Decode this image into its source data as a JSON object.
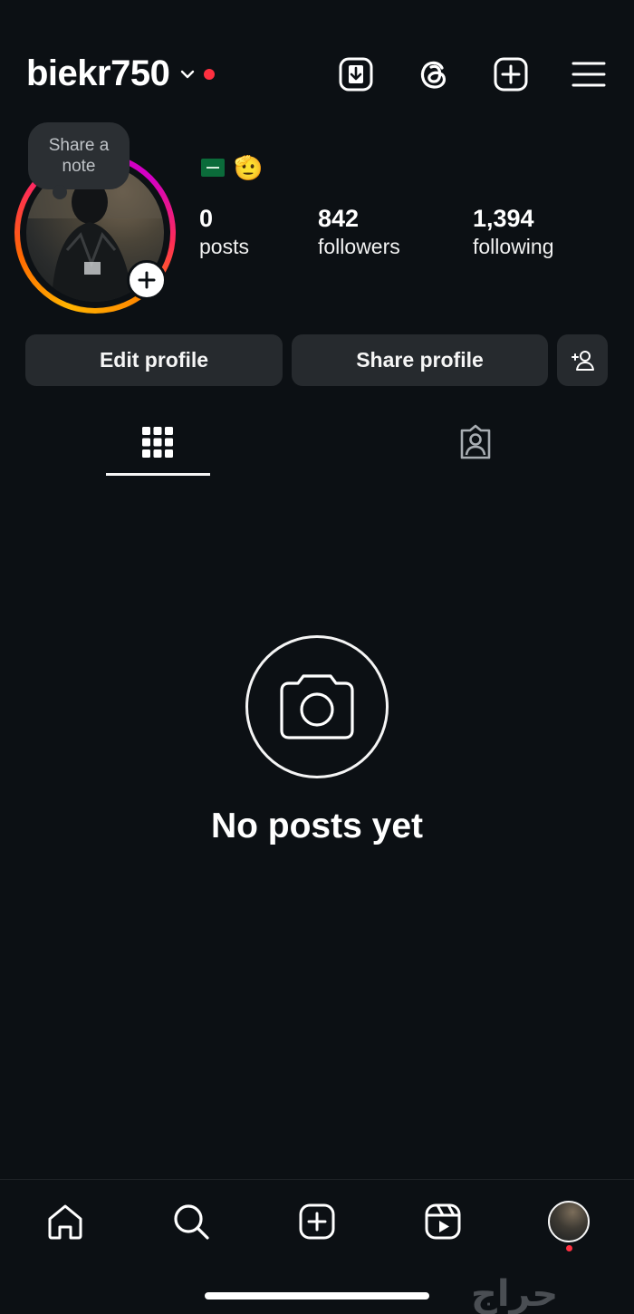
{
  "header": {
    "username": "biekr750",
    "icons": [
      "download-box-icon",
      "threads-icon",
      "add-post-icon",
      "menu-icon"
    ]
  },
  "note": {
    "text_line1": "Share a",
    "text_line2": "note"
  },
  "bio": {
    "emojis": [
      "saudi-flag",
      "saluting-hand"
    ],
    "hand_char": "🫡"
  },
  "stats": {
    "posts": {
      "value": "0",
      "label": "posts"
    },
    "followers": {
      "value": "842",
      "label": "followers"
    },
    "following": {
      "value": "1,394",
      "label": "following"
    }
  },
  "actions": {
    "edit_profile": "Edit profile",
    "share_profile": "Share profile",
    "discover_people_icon": "add-person-icon"
  },
  "tabs": [
    {
      "name": "grid",
      "icon": "grid-icon",
      "active": true
    },
    {
      "name": "tagged",
      "icon": "tagged-person-icon",
      "active": false
    }
  ],
  "empty_state": {
    "icon": "camera-icon",
    "text": "No posts yet"
  },
  "bottom_nav": {
    "items": [
      "home-icon",
      "search-icon",
      "create-icon",
      "reels-icon",
      "profile-avatar"
    ],
    "profile_notification": true
  },
  "watermark": "حراج",
  "colors": {
    "background": "#0c1014",
    "button": "#262a2e",
    "notification": "#ff3040",
    "text": "#f5f5f5"
  }
}
